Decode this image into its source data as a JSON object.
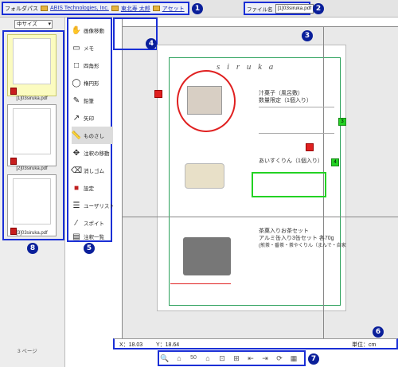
{
  "folderpath": {
    "label": "フォルダパス",
    "crumbs": [
      "ABIS Technologies, Inc.",
      "東北寿 太郎",
      "アセット"
    ]
  },
  "filename": {
    "label": "ファイル名",
    "value": "[1]03siruka.pdf"
  },
  "thumbs": {
    "size_select": "中サイズ",
    "items": [
      {
        "label": "[1]03siruka.pdf"
      },
      {
        "label": "[2]03siruka.pdf"
      },
      {
        "label": "[3]03siruka.pdf"
      }
    ],
    "page_count": "3 ページ"
  },
  "tools": [
    {
      "label": "画像移動",
      "icon": "hand-icon"
    },
    {
      "label": "メモ",
      "icon": "memo-icon"
    },
    {
      "label": "四角形",
      "icon": "rectangle-icon"
    },
    {
      "label": "楕円形",
      "icon": "ellipse-icon"
    },
    {
      "label": "鉛筆",
      "icon": "pencil-icon"
    },
    {
      "label": "矢印",
      "icon": "arrow-icon"
    },
    {
      "label": "ものさし",
      "icon": "ruler-icon"
    },
    {
      "label": "注釈の移動",
      "icon": "move-annotation-icon"
    },
    {
      "label": "消しゴム",
      "icon": "eraser-icon"
    },
    {
      "label": "設定",
      "icon": "settings-icon"
    },
    {
      "label": "ユーザリスト",
      "icon": "user-list-icon"
    },
    {
      "label": "スポイト",
      "icon": "eyedropper-icon"
    },
    {
      "label": "注釈一覧",
      "icon": "annotation-list-icon"
    }
  ],
  "status": {
    "x": "X：18.03",
    "y": "Y：18.64",
    "unit": "単位：cm"
  },
  "zoom": "50",
  "doc": {
    "brand": "s i r u k a",
    "p1_title": "汁菓子（風呂敷）",
    "p1_sub": "数量限定（1個入り）",
    "p2_title": "あいすくりん（1個入り）",
    "p3_title": "茶菓入りお茶セット",
    "p3_sub": "アルミ缶入り3缶セット 各70g",
    "p3_sub2": "(煎茶・番茶・茶やくりん（まんで・自家"
  },
  "colors": {
    "accent": "#1a2fd6",
    "annotation_red": "#e02020",
    "annotation_green": "#23d223"
  },
  "markers": [
    "1",
    "2",
    "3",
    "4",
    "5",
    "6",
    "7",
    "8"
  ]
}
